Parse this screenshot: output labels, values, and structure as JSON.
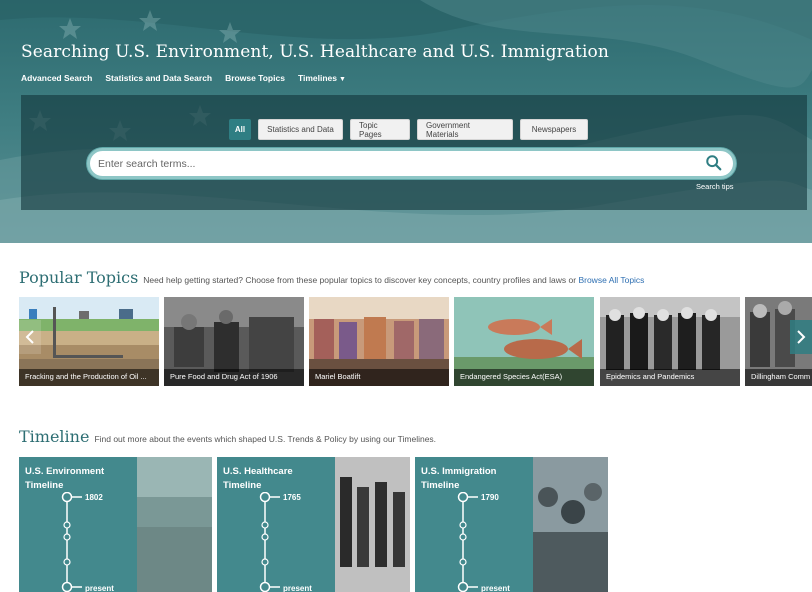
{
  "hero": {
    "title": "Searching U.S. Environment, U.S. Healthcare and U.S. Immigration",
    "nav": {
      "advanced": "Advanced Search",
      "stats": "Statistics and Data Search",
      "browse": "Browse Topics",
      "timelines": "Timelines"
    }
  },
  "search": {
    "tabs": {
      "all": "All",
      "stats": "Statistics and Data",
      "topic_pages": "Topic Pages",
      "government": "Government Materials",
      "newspapers": "Newspapers"
    },
    "placeholder": "Enter search terms...",
    "tips": "Search tips"
  },
  "popular": {
    "title": "Popular Topics",
    "description": "Need help getting started? Choose from these popular topics to discover key concepts, country profiles and laws or",
    "browse_link": "Browse All Topics",
    "cards": [
      {
        "label": "Fracking and the Production of Oil ..."
      },
      {
        "label": "Pure Food and Drug Act of 1906"
      },
      {
        "label": "Mariel Boatlift"
      },
      {
        "label": "Endangered Species Act(ESA)"
      },
      {
        "label": "Epidemics and Pandemics"
      },
      {
        "label": "Dillingham Comm"
      }
    ]
  },
  "timeline": {
    "title": "Timeline",
    "description": "Find out more about the events which shaped U.S. Trends & Policy by using our Timelines.",
    "cards": [
      {
        "name": "U.S. Environment",
        "word": "Timeline",
        "start": "1802",
        "end": "present"
      },
      {
        "name": "U.S. Healthcare",
        "word": "Timeline",
        "start": "1765",
        "end": "present"
      },
      {
        "name": "U.S. Immigration",
        "word": "Timeline",
        "start": "1790",
        "end": "present"
      }
    ]
  },
  "colors": {
    "teal_dark": "#2d6a6f",
    "teal_accent": "#2f7e83",
    "timeline_card": "#43898d",
    "link_blue": "#2e6fb2",
    "section_title": "#2d6e73"
  }
}
